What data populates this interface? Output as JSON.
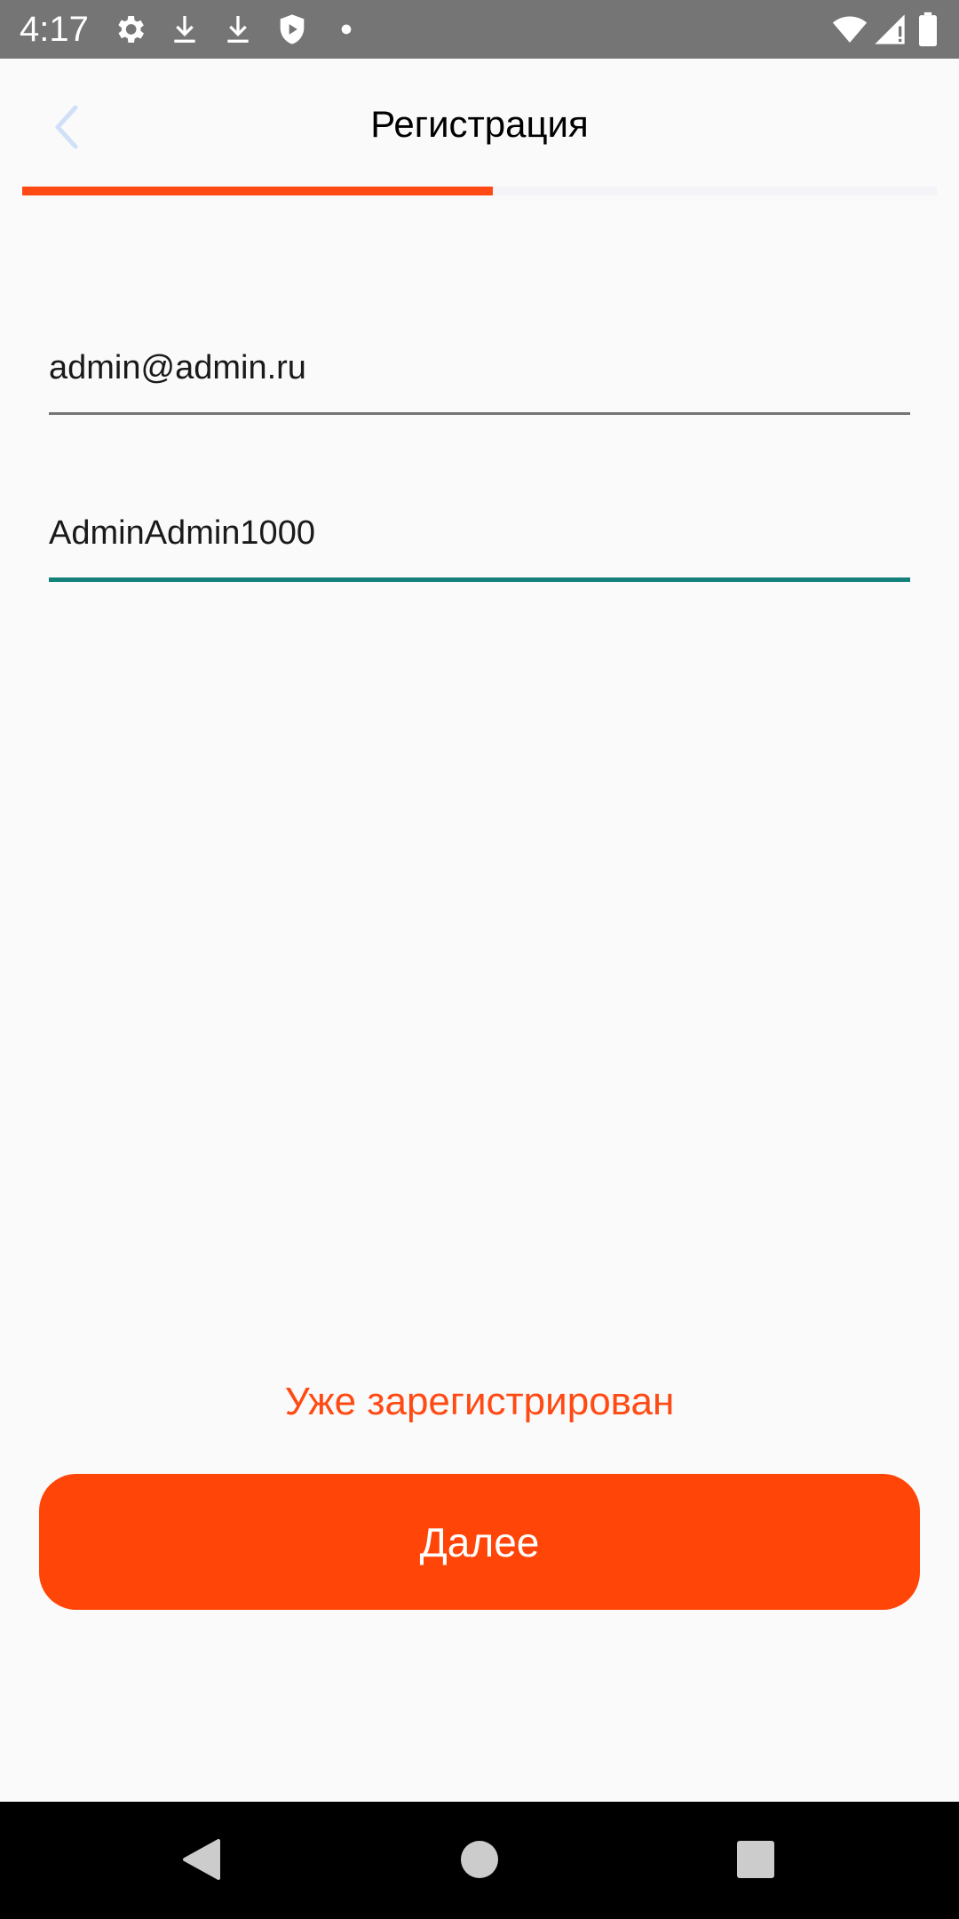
{
  "status_bar": {
    "time": "4:17",
    "left_icons": [
      "gear-icon",
      "download-icon",
      "download-icon",
      "shield-play-icon",
      "dot-icon"
    ],
    "right_icons": [
      "wifi-icon",
      "signal-icon",
      "battery-icon"
    ],
    "background": "#757575"
  },
  "header": {
    "title": "Регистрация",
    "back_icon": "chevron-left-icon"
  },
  "progress": {
    "value": 0.515,
    "fill_color": "#ff4a14"
  },
  "form": {
    "email": {
      "value": "admin@admin.ru"
    },
    "password": {
      "value": "AdminAdmin1000"
    }
  },
  "actions": {
    "already_registered_label": "Уже зарегистрирован",
    "next_label": "Далее",
    "accent": "#ff4508"
  },
  "nav_bar": {
    "buttons": [
      "back-triangle-icon",
      "home-circle-icon",
      "recents-square-icon"
    ]
  }
}
